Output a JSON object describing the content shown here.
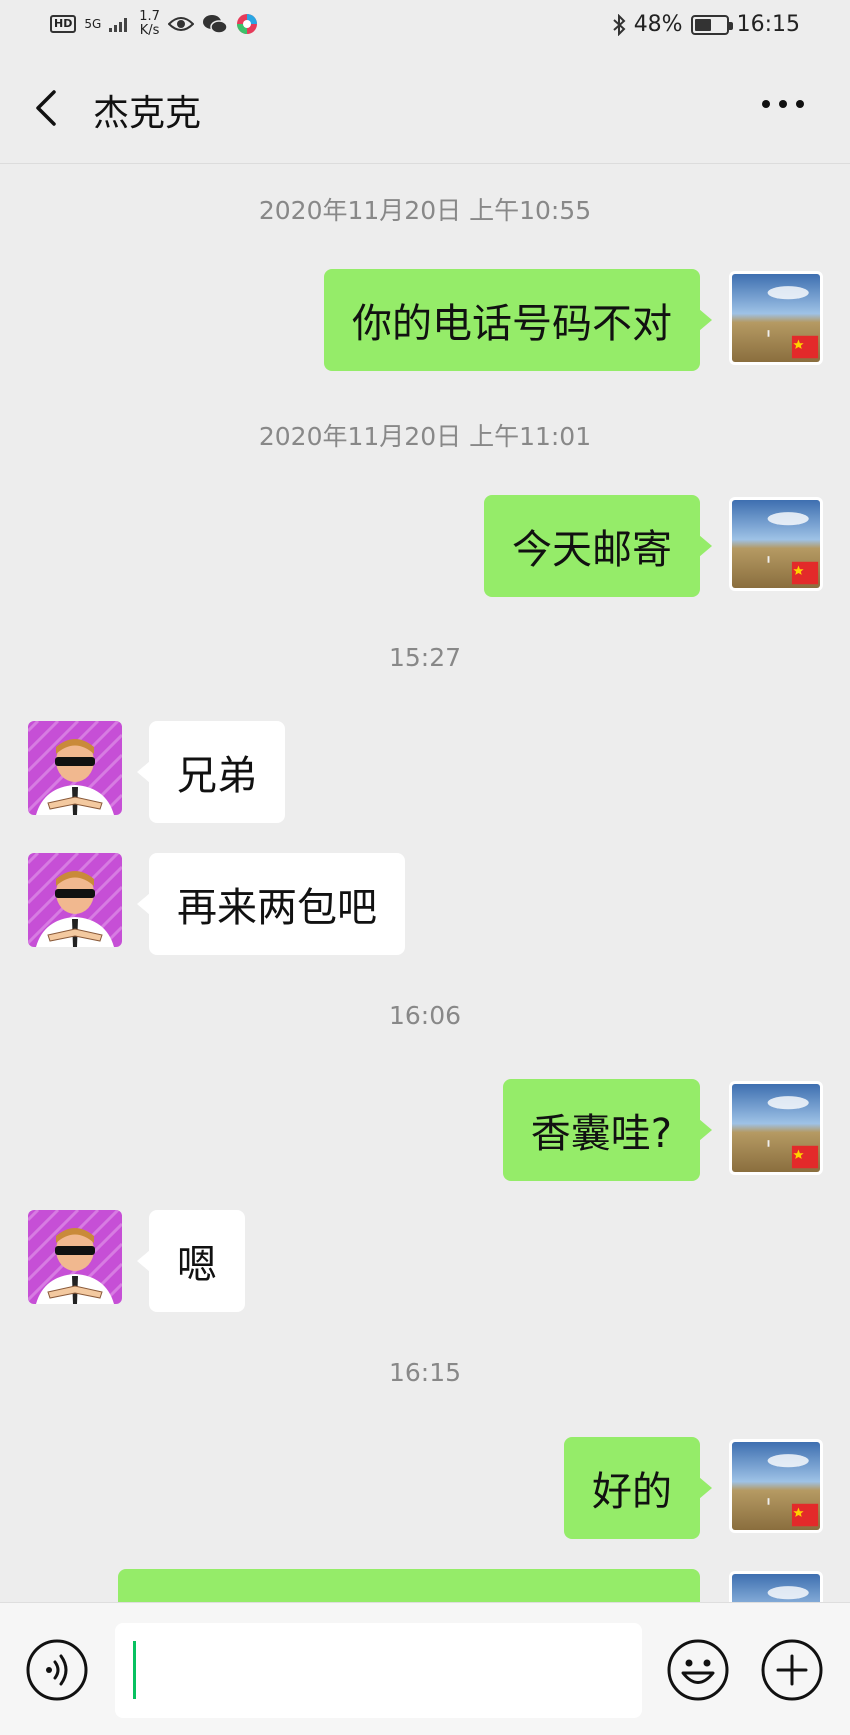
{
  "status_bar": {
    "network": "HD",
    "signal": "5G",
    "speed_value": "1.7",
    "speed_unit": "K/s",
    "battery": "48%",
    "battery_level": 0.48,
    "time": "16:15"
  },
  "header": {
    "title": "杰克克"
  },
  "timestamps": [
    "2020年11月20日 上午10:55",
    "2020年11月20日 上午11:01",
    "15:27",
    "16:06",
    "16:15"
  ],
  "messages": [
    {
      "sender": "me",
      "text": "你的电话号码不对"
    },
    {
      "sender": "me",
      "text": "今天邮寄"
    },
    {
      "sender": "them",
      "text": "兄弟"
    },
    {
      "sender": "them",
      "text": "再来两包吧"
    },
    {
      "sender": "me",
      "text": "香囊哇?"
    },
    {
      "sender": "them",
      "text": "嗯"
    },
    {
      "sender": "me",
      "text": "好的"
    },
    {
      "sender": "me",
      "text": ""
    }
  ],
  "icons": {
    "back": "chevron-left-icon",
    "more": "more-dots-icon",
    "voice": "voice-icon",
    "emoji": "emoji-icon",
    "plus": "plus-icon"
  },
  "colors": {
    "chat_background": "#ededed",
    "sent_bubble": "#95ec69",
    "received_bubble": "#ffffff",
    "cursor": "#07c160"
  }
}
